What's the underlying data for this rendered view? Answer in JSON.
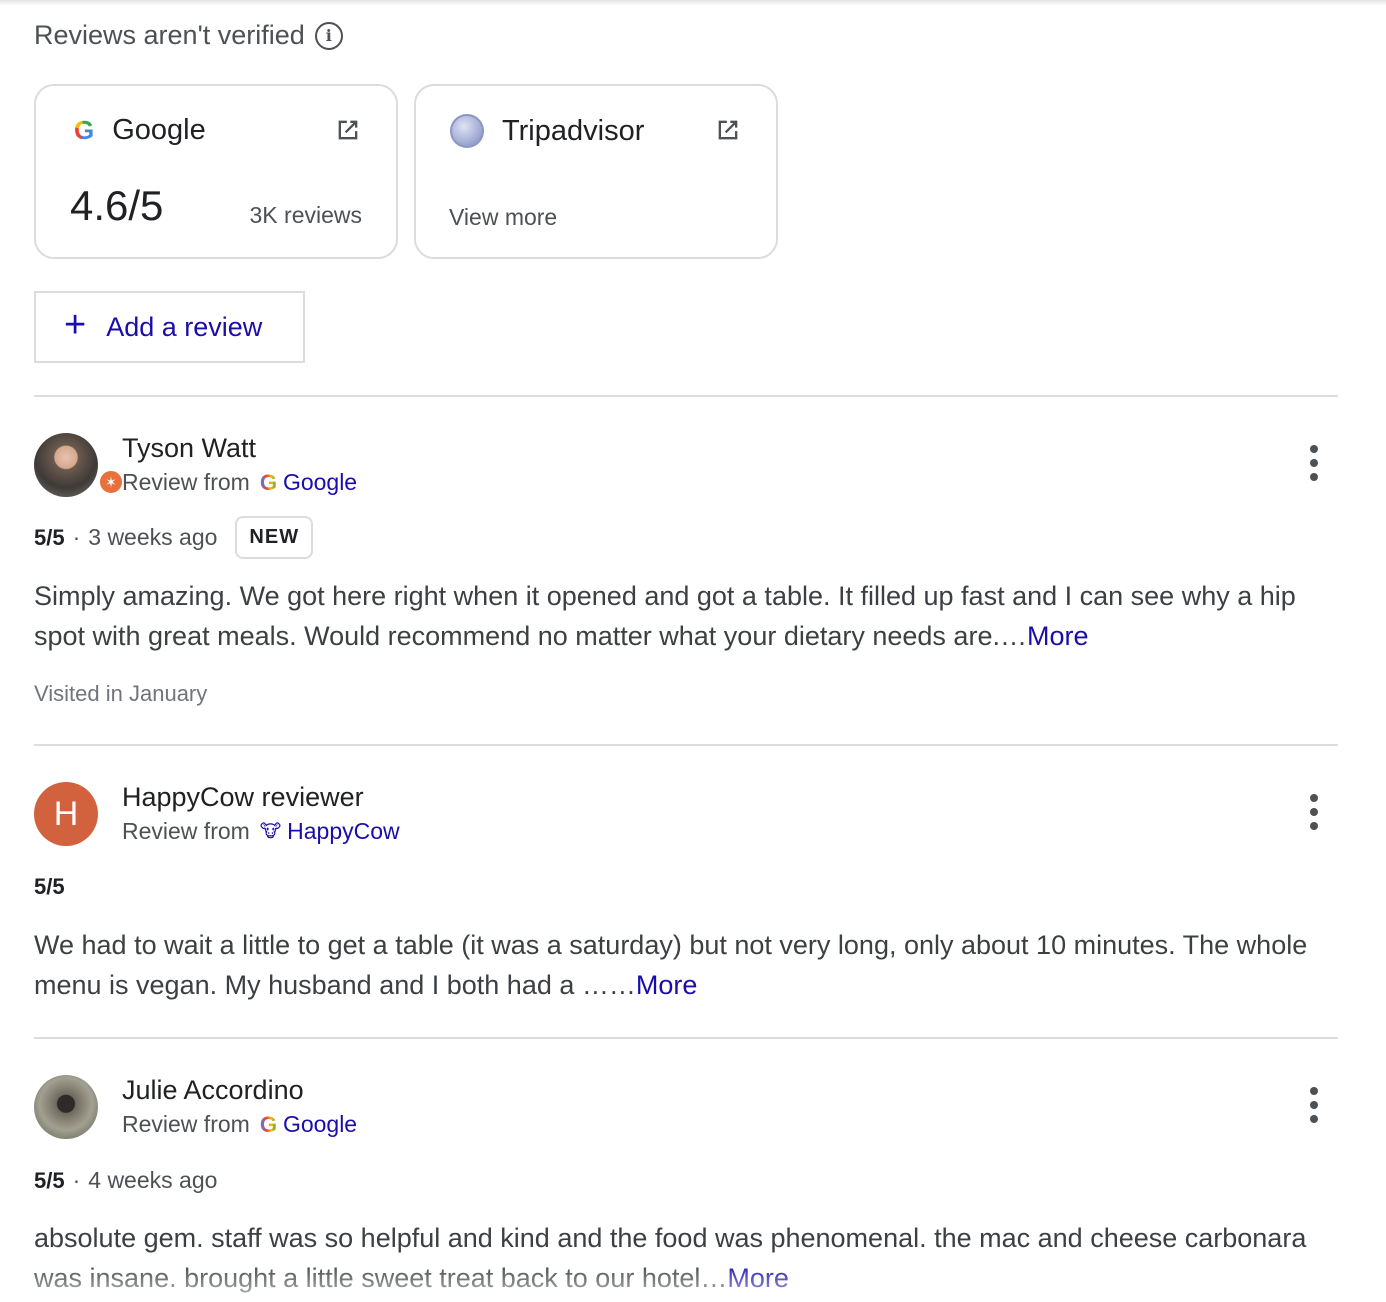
{
  "header": {
    "title": "Reviews aren't verified",
    "info_icon": "i"
  },
  "sources": {
    "google": {
      "name": "Google",
      "logo": "G",
      "rating": "4.6/5",
      "count": "3K reviews"
    },
    "tripadvisor": {
      "name": "Tripadvisor",
      "action": "View more"
    }
  },
  "add_review": {
    "icon": "+",
    "label": "Add a review"
  },
  "reviews": [
    {
      "name": "Tyson Watt",
      "from_label": "Review from",
      "source": "Google",
      "source_logo": "G",
      "score": "5/5",
      "sep": "·",
      "time": "3 weeks ago",
      "badge": "NEW",
      "text": "Simply amazing. We got here right when it opened and got a table. It filled up fast and I can see why a hip spot with great meals. Would recommend no matter what your dietary needs are.…",
      "more": "More",
      "visited": "Visited in January"
    },
    {
      "name": "HappyCow reviewer",
      "avatar_letter": "H",
      "from_label": "Review from",
      "source": "HappyCow",
      "source_logo": "🐮",
      "score": "5/5",
      "text": "We had to wait a little to get a table (it was a saturday) but not very long, only about 10 minutes. The whole menu is vegan. My husband and I both had a ……",
      "more": "More"
    },
    {
      "name": "Julie Accordino",
      "from_label": "Review from",
      "source": "Google",
      "source_logo": "G",
      "score": "5/5",
      "sep": "·",
      "time": "4 weeks ago",
      "text": "absolute gem. staff was so helpful and kind and the food was phenomenal. the mac and cheese carbonara was insane. brought a little sweet treat back to our hotel…",
      "more": "More"
    }
  ],
  "colors": {
    "link": "#1a0dab",
    "text": "#202124",
    "muted": "#4d5156",
    "border": "#dadce0",
    "avatar_h": "#d2613e"
  }
}
